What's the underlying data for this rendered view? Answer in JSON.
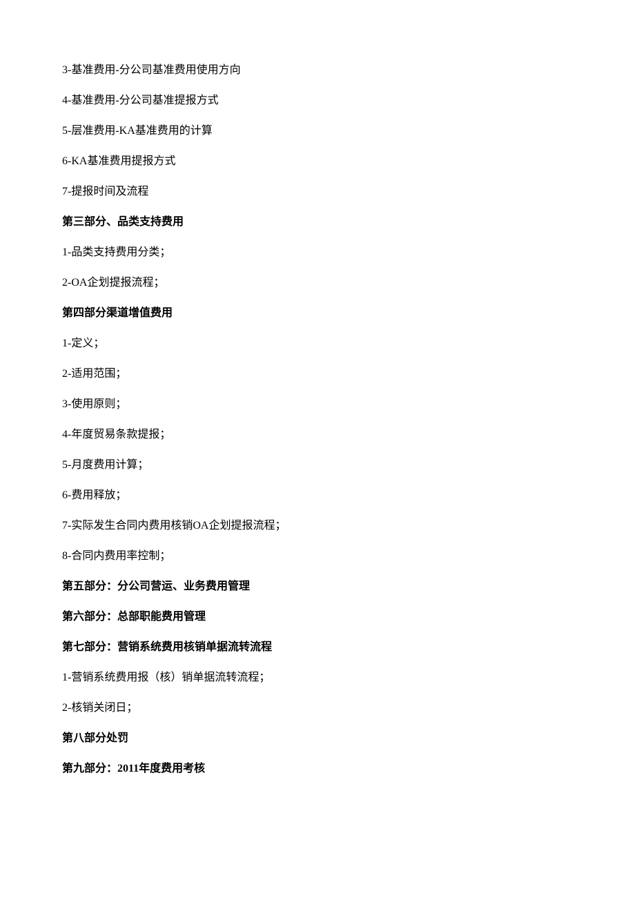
{
  "lines": [
    {
      "text": "3-基准费用-分公司基准费用使用方向",
      "bold": false
    },
    {
      "text": "4-基准费用-分公司基准提报方式",
      "bold": false
    },
    {
      "text": "5-层准费用-KA基准费用的计算",
      "bold": false
    },
    {
      "text": "6-KA基准费用提报方式",
      "bold": false
    },
    {
      "text": "7-提报时间及流程",
      "bold": false
    },
    {
      "text": "第三部分、品类支持费用",
      "bold": true
    },
    {
      "text": "1-品类支持费用分类；",
      "bold": false
    },
    {
      "text": "2-OA企划提报流程；",
      "bold": false
    },
    {
      "text": "第四部分渠道增值费用",
      "bold": true
    },
    {
      "text": "1-定义；",
      "bold": false
    },
    {
      "text": "2-适用范围；",
      "bold": false
    },
    {
      "text": "3-使用原则；",
      "bold": false
    },
    {
      "text": "4-年度贸易条款提报；",
      "bold": false
    },
    {
      "text": "5-月度费用计算；",
      "bold": false
    },
    {
      "text": "6-费用释放；",
      "bold": false
    },
    {
      "text": "7-实际发生合同内费用核销OA企划提报流程；",
      "bold": false
    },
    {
      "text": "8-合同内费用率控制；",
      "bold": false
    },
    {
      "text": "第五部分：分公司营运、业务费用管理",
      "bold": true
    },
    {
      "text": "第六部分：总部职能费用管理",
      "bold": true
    },
    {
      "text": "第七部分：营销系统费用核销单据流转流程",
      "bold": true
    },
    {
      "text": "1-营销系统费用报（核）销单据流转流程；",
      "bold": false
    },
    {
      "text": "2-核销关闭日；",
      "bold": false
    },
    {
      "text": "第八部分处罚",
      "bold": true
    },
    {
      "text": "第九部分：2011年度费用考核",
      "bold": true
    }
  ]
}
